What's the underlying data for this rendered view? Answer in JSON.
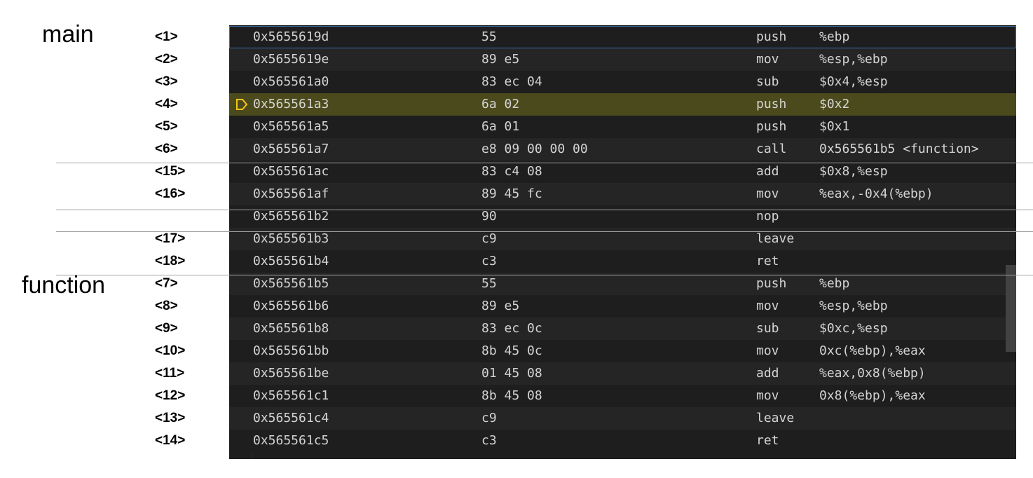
{
  "labels": {
    "main": "main",
    "function": "function"
  },
  "rows": [
    {
      "step": "<1>",
      "addr": "0x5655619d",
      "bytes": "55",
      "op": "push",
      "args": "%ebp"
    },
    {
      "step": "<2>",
      "addr": "0x5655619e",
      "bytes": "89 e5",
      "op": "mov",
      "args": "%esp,%ebp"
    },
    {
      "step": "<3>",
      "addr": "0x565561a0",
      "bytes": "83 ec 04",
      "op": "sub",
      "args": "$0x4,%esp"
    },
    {
      "step": "<4>",
      "addr": "0x565561a3",
      "bytes": "6a 02",
      "op": "push",
      "args": "$0x2",
      "current": true
    },
    {
      "step": "<5>",
      "addr": "0x565561a5",
      "bytes": "6a 01",
      "op": "push",
      "args": "$0x1"
    },
    {
      "step": "<6>",
      "addr": "0x565561a7",
      "bytes": "e8 09 00 00 00",
      "op": "call",
      "args": "0x565561b5 <function>"
    },
    {
      "step": "<15>",
      "addr": "0x565561ac",
      "bytes": "83 c4 08",
      "op": "add",
      "args": "$0x8,%esp"
    },
    {
      "step": "<16>",
      "addr": "0x565561af",
      "bytes": "89 45 fc",
      "op": "mov",
      "args": "%eax,-0x4(%ebp)"
    },
    {
      "step": "",
      "addr": "0x565561b2",
      "bytes": "90",
      "op": "nop",
      "args": ""
    },
    {
      "step": "<17>",
      "addr": "0x565561b3",
      "bytes": "c9",
      "op": "leave",
      "args": ""
    },
    {
      "step": "<18>",
      "addr": "0x565561b4",
      "bytes": "c3",
      "op": "ret",
      "args": ""
    },
    {
      "step": "<7>",
      "addr": "0x565561b5",
      "bytes": "55",
      "op": "push",
      "args": "%ebp"
    },
    {
      "step": "<8>",
      "addr": "0x565561b6",
      "bytes": "89 e5",
      "op": "mov",
      "args": "%esp,%ebp"
    },
    {
      "step": "<9>",
      "addr": "0x565561b8",
      "bytes": "83 ec 0c",
      "op": "sub",
      "args": "$0xc,%esp"
    },
    {
      "step": "<10>",
      "addr": "0x565561bb",
      "bytes": "8b 45 0c",
      "op": "mov",
      "args": "0xc(%ebp),%eax"
    },
    {
      "step": "<11>",
      "addr": "0x565561be",
      "bytes": "01 45 08",
      "op": "add",
      "args": "%eax,0x8(%ebp)"
    },
    {
      "step": "<12>",
      "addr": "0x565561c1",
      "bytes": "8b 45 08",
      "op": "mov",
      "args": "0x8(%ebp),%eax"
    },
    {
      "step": "<13>",
      "addr": "0x565561c4",
      "bytes": "c9",
      "op": "leave",
      "args": ""
    },
    {
      "step": "<14>",
      "addr": "0x565561c5",
      "bytes": "c3",
      "op": "ret",
      "args": ""
    }
  ],
  "colors": {
    "current_line": "#4b4a1c",
    "ip_marker": "#f5c518"
  },
  "icons": {
    "current_instruction": "instruction-pointer-icon"
  }
}
